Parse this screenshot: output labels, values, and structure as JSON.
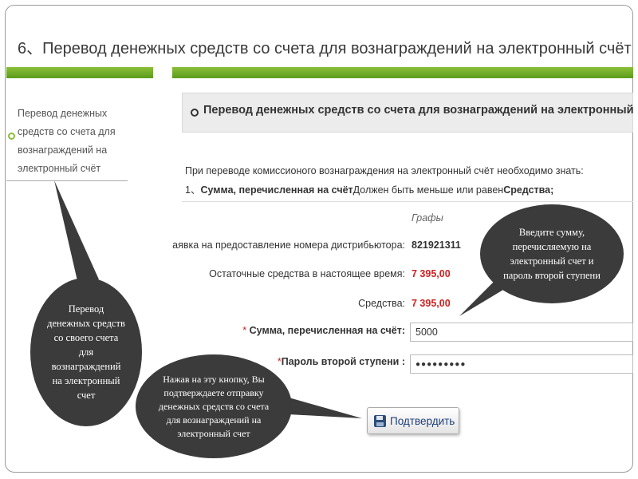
{
  "slide": {
    "title": "6、Перевод денежных средств со счета для вознаграждений на электронный счёт"
  },
  "sidebar": {
    "item_label": "Перевод денежных средств со счета для вознаграждений на электронный счёт"
  },
  "main": {
    "section_title": "Перевод денежных средств со счета для вознаграждений на электронный счёт",
    "info_line1": "При переводе комиссионого вознаграждения на электронный счёт необходимо знать:",
    "info_line2_prefix": "1、",
    "info_line2_bold1": "Сумма, перечисленная на счёт",
    "info_line2_mid": "Должен быть меньше или равен",
    "info_line2_bold2": "Средства",
    "info_line2_suffix": ";",
    "column_header": "Графы",
    "rows": {
      "distributor_label": "Заявка на предоставление номера дистрибьютора:",
      "distributor_value": "821921311",
      "remaining_label": "Остаточные средства в настоящее время:",
      "remaining_value": "7 395,00",
      "funds_label": "Средства:",
      "funds_value": "7 395,00",
      "amount_required": "* ",
      "amount_label": "Сумма, перечисленная на счёт:",
      "amount_value": "5000",
      "password_required": "*",
      "password_label": "Пароль второй ступени :",
      "password_value": "●●●●●●●●●"
    },
    "confirm_button": "Подтвердить"
  },
  "callouts": {
    "left": "Перевод денежных средств со своего счета для вознаграждений на электронный счет",
    "middle": "Нажав на эту кнопку, Вы подтверждаете отправку денежных средств со счета для вознаграждений на электронный счет",
    "right": "Введите сумму, перечисляемую на электронный счет и пароль второй ступени"
  },
  "colors": {
    "accent_green": "#6aa824",
    "value_red": "#cc2222",
    "callout_bg": "#3b3b3b"
  }
}
